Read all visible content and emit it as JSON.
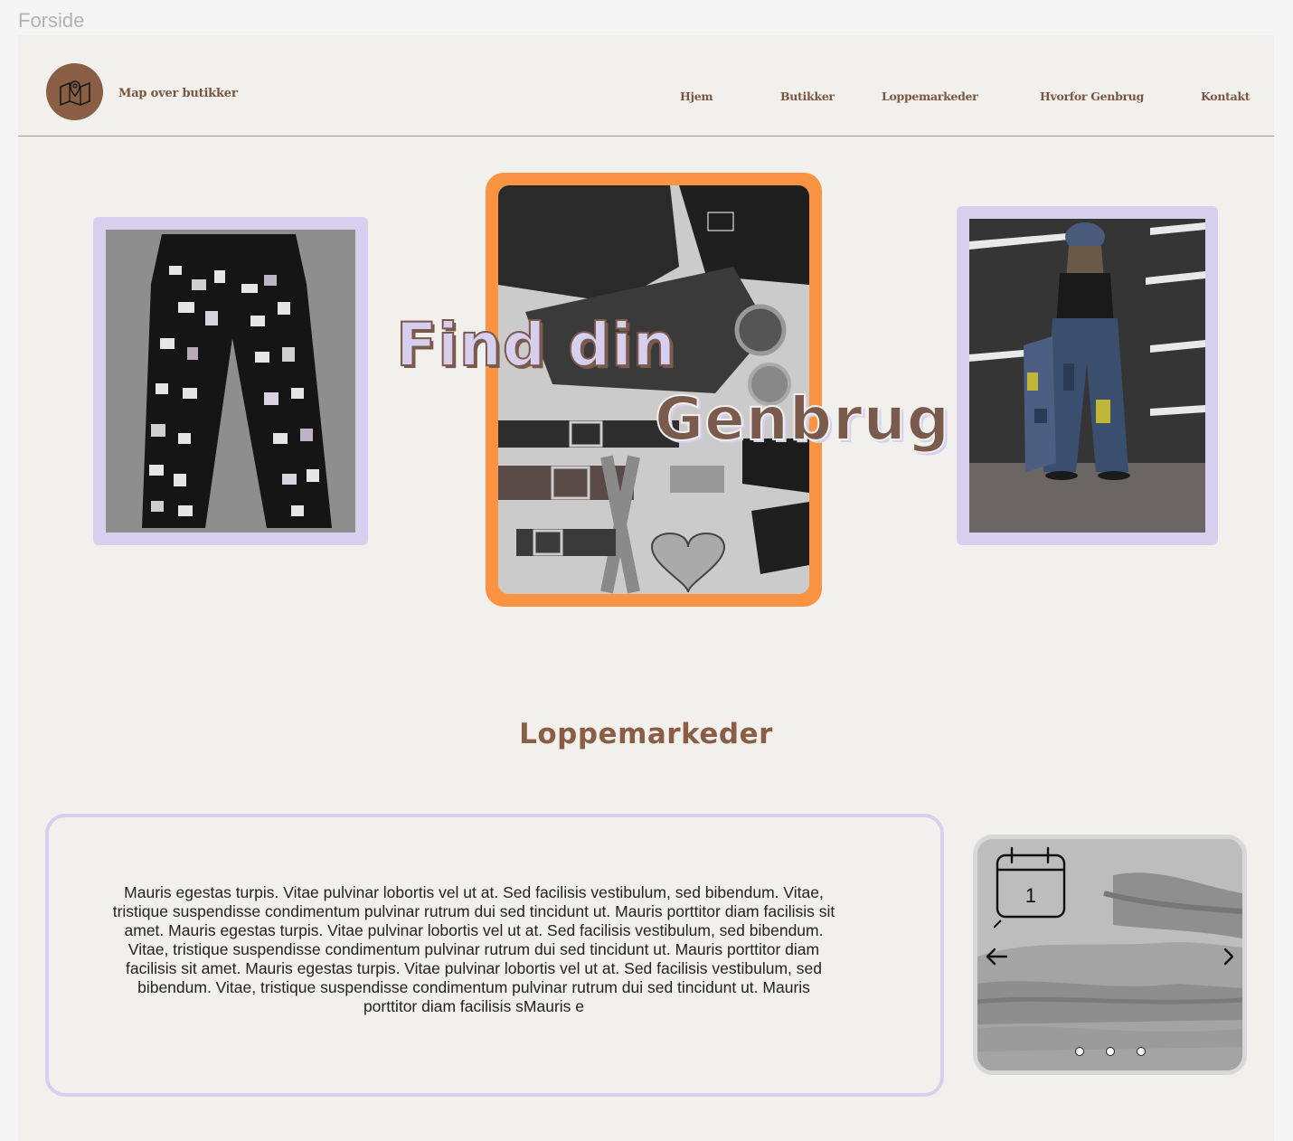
{
  "frame_label": "Forside",
  "header": {
    "logo_text": "Map over butikker",
    "logo_icon": "map-pin-icon",
    "nav": [
      {
        "label": "Hjem"
      },
      {
        "label": "Butikker"
      },
      {
        "label": "Loppemarkeder"
      },
      {
        "label": "Hvorfor Genbrug"
      },
      {
        "label": "Kontakt"
      }
    ]
  },
  "hero": {
    "line1": "Find din",
    "line2": "Genbrug"
  },
  "section": {
    "title": "Loppemarkeder",
    "body": "Mauris egestas turpis. Vitae pulvinar lobortis vel ut at. Sed facilisis vestibulum, sed bibendum. Vitae, tristique suspendisse condimentum pulvinar rutrum dui sed tincidunt ut. Mauris porttitor diam facilisis sit amet. Mauris egestas turpis. Vitae pulvinar lobortis vel ut at. Sed facilisis vestibulum, sed bibendum. Vitae, tristique suspendisse condimentum pulvinar rutrum dui sed tincidunt ut. Mauris porttitor diam facilisis sit amet. Mauris egestas turpis. Vitae pulvinar lobortis vel ut at. Sed facilisis vestibulum, sed bibendum. Vitae, tristique suspendisse condimentum pulvinar rutrum dui sed tincidunt ut. Mauris porttitor diam facilisis sMauris e"
  },
  "carousel": {
    "calendar_day": "1",
    "icons": [
      "calendar-icon",
      "arrow-left-icon",
      "chevron-right-icon"
    ],
    "dots": 3
  },
  "colors": {
    "brown": "#8a5e45",
    "lavender": "#d6d0ee",
    "orange": "#fb9442",
    "background": "#f1f0ed"
  }
}
